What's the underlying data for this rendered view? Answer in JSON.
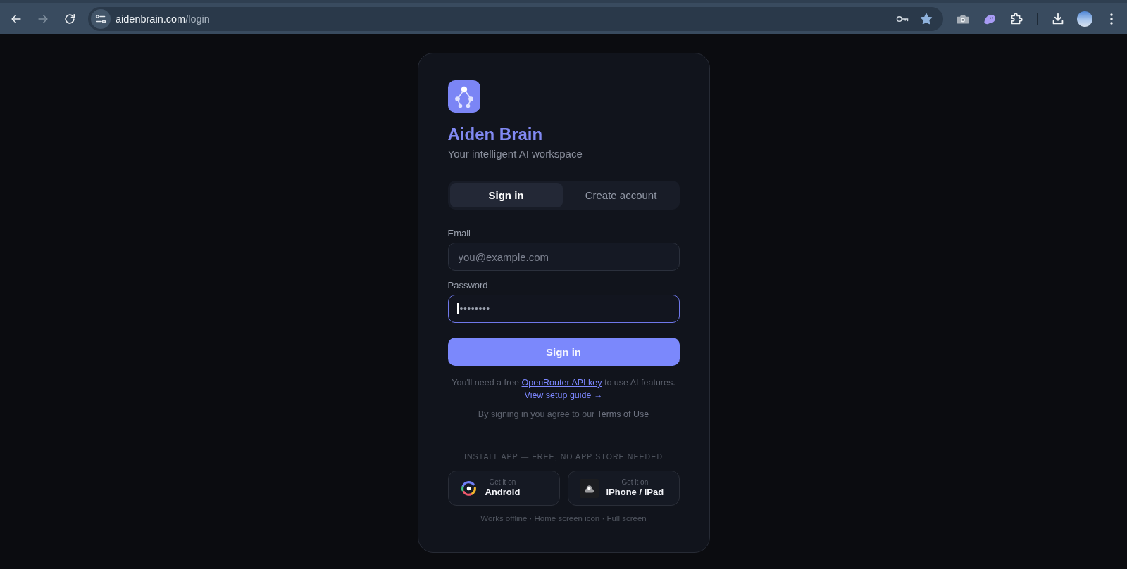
{
  "browser": {
    "nav": [
      {
        "kind": "back",
        "disabled": false
      },
      {
        "kind": "forward",
        "disabled": true
      },
      {
        "kind": "reload",
        "disabled": false
      }
    ],
    "url": {
      "host": "aidenbrain.com",
      "path": "/login"
    },
    "bookmarked": true
  },
  "brand": {
    "title": "Aiden Brain",
    "tagline": "Your intelligent AI workspace"
  },
  "tabs": [
    {
      "label": "Sign in",
      "selected": true
    },
    {
      "label": "Create account",
      "selected": false
    }
  ],
  "fields": [
    {
      "kind": "email",
      "label": "Email",
      "placeholder": "you@example.com",
      "focused": false
    },
    {
      "kind": "password",
      "label": "Password",
      "value": "••••••••",
      "focused": true
    }
  ],
  "submit": {
    "label": "Sign in"
  },
  "notice": {
    "before": "You'll need a free",
    "link": "OpenRouter API key",
    "after": "to use AI features.",
    "guide_link": "View setup guide →"
  },
  "terms": {
    "before": "By signing in you agree to our",
    "link": "Terms of Use"
  },
  "install": {
    "caption": "INSTALL APP — FREE, NO APP STORE NEEDED",
    "options": [
      {
        "kind": "android",
        "overline": "Get it on",
        "label": "Android"
      },
      {
        "kind": "ios",
        "overline": "Get it on",
        "label": "iPhone / iPad"
      }
    ],
    "features": "Works offline · Home screen icon · Full screen"
  }
}
